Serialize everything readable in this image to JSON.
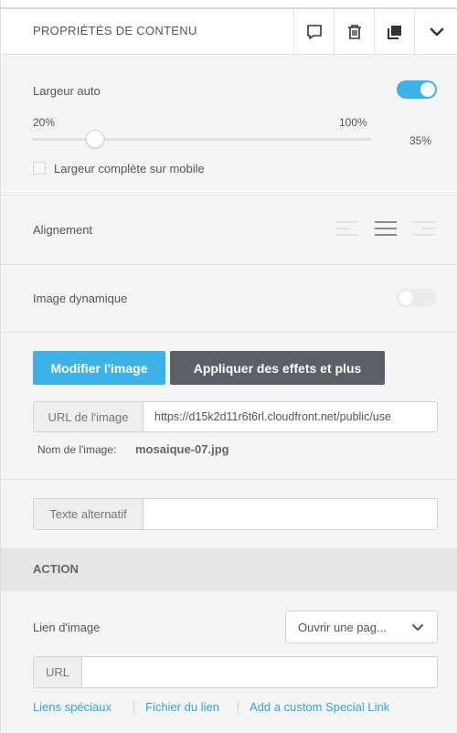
{
  "header": {
    "title": "PROPRIÉTÉS DE CONTENU"
  },
  "width": {
    "auto_label": "Largeur auto",
    "auto_enabled": true,
    "slider_min": "20%",
    "slider_max": "100%",
    "slider_value": "35%",
    "mobile_full_label": "Largeur complète sur mobile"
  },
  "alignment": {
    "label": "Alignement"
  },
  "dynamic_image": {
    "label": "Image dynamique",
    "enabled": false
  },
  "image": {
    "modify_label": "Modifier l'image",
    "effects_label": "Appliquer des effets et plus",
    "url_addon": "URL de l'image",
    "url_value": "https://d15k2d11r6t6rl.cloudfront.net/public/use",
    "name_label": "Nom de l'image:",
    "name_value": "mosaique-07.jpg",
    "alt_addon": "Texte alternatif",
    "alt_value": ""
  },
  "action": {
    "title": "ACTION",
    "link_label": "Lien d'image",
    "link_select": "Ouvrir une pag...",
    "url_addon": "URL",
    "url_value": "",
    "links": [
      "Liens spéciaux",
      "Fichier du lien",
      "Add a custom Special Link"
    ]
  },
  "colors": {
    "accent": "#3cb2e8",
    "dark_button": "#5b6068",
    "toggle_off": "#ececec"
  }
}
